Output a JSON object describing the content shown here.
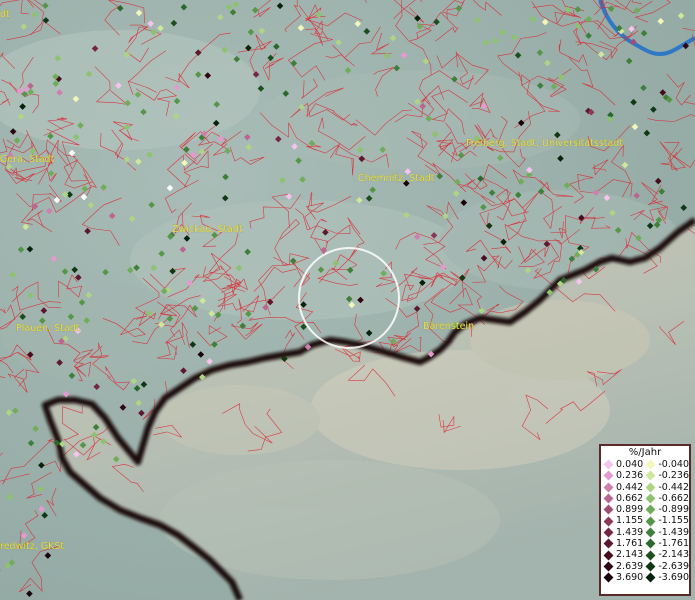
{
  "map": {
    "labels": [
      {
        "id": "gera",
        "text": "Gera, Stadt"
      },
      {
        "id": "chemnitz",
        "text": "Chemnitz, Stadt"
      },
      {
        "id": "freiberg",
        "text": "Freiberg, Stadt, Universitätsstadt"
      },
      {
        "id": "zwickau",
        "text": "Zwickau, Stadt"
      },
      {
        "id": "plauen",
        "text": "Plauen, Stadt"
      },
      {
        "id": "baerenstein",
        "text": "Bärenstein"
      },
      {
        "id": "redwitz",
        "text": "redwitz, GKSt"
      },
      {
        "id": "topleft",
        "text": "dt"
      }
    ],
    "colors": {
      "background": "#9fb2ae",
      "boundary_lines": "#e0202a",
      "border": "#1a0d0d",
      "river": "#2f78c6",
      "highlight_circle": "#ffffff"
    }
  },
  "legend": {
    "title": "%/Jahr",
    "positive": [
      {
        "label": "0.040",
        "color": "#f6c3ef"
      },
      {
        "label": "0.236",
        "color": "#e49ad0"
      },
      {
        "label": "0.442",
        "color": "#cf7fae"
      },
      {
        "label": "0.662",
        "color": "#bb6590"
      },
      {
        "label": "0.899",
        "color": "#a44d74"
      },
      {
        "label": "1.155",
        "color": "#8d3859"
      },
      {
        "label": "1.439",
        "color": "#762641"
      },
      {
        "label": "1.761",
        "color": "#5e182d"
      },
      {
        "label": "2.143",
        "color": "#470d1d"
      },
      {
        "label": "2.639",
        "color": "#300610"
      },
      {
        "label": "3.690",
        "color": "#1a0107"
      }
    ],
    "negative": [
      {
        "label": "-0.040",
        "color": "#f3f6b9"
      },
      {
        "label": "-0.236",
        "color": "#cfe79c"
      },
      {
        "label": "-0.442",
        "color": "#aed585"
      },
      {
        "label": "-0.662",
        "color": "#8dc26f"
      },
      {
        "label": "-0.899",
        "color": "#6fad5b"
      },
      {
        "label": "-1.155",
        "color": "#559649"
      },
      {
        "label": "-1.439",
        "color": "#3e7f39"
      },
      {
        "label": "-1.761",
        "color": "#2b682b"
      },
      {
        "label": "-2.143",
        "color": "#1b501e"
      },
      {
        "label": "-2.639",
        "color": "#0e3913"
      },
      {
        "label": "-3.690",
        "color": "#04230a"
      }
    ]
  }
}
